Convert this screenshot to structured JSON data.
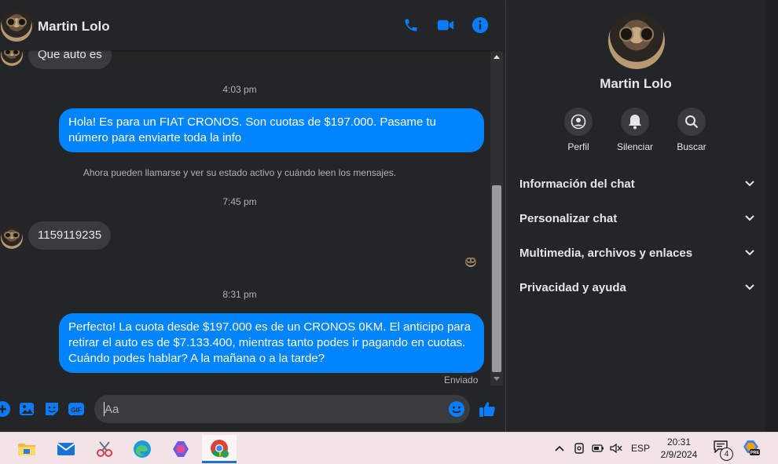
{
  "contact": {
    "name": "Martin Lolo"
  },
  "header": {
    "icons": [
      "phone-icon",
      "video-icon",
      "info-icon"
    ]
  },
  "messages": {
    "m1": "Que auto es",
    "ts1": "4:03 pm",
    "m2": "Hola! Es para un FIAT CRONOS. Son cuotas de $197.000. Pasame tu número para enviarte toda la info",
    "system": "Ahora pueden llamarse y ver su estado activo y cuándo leen los mensajes.",
    "ts2": "7:45 pm",
    "m3": "1159119235",
    "ts3": "8:31 pm",
    "m4": "Perfecto! La cuota desde $197.000 es de un CRONOS 0KM. El anticipo para retirar el auto es de $7.133.400, mientras tanto podes ir pagando en cuotas. Cuándo podes hablar? A la mañana o a la tarde?",
    "status": "Enviado"
  },
  "composer": {
    "placeholder": "Aa"
  },
  "info": {
    "name": "Martin Lolo",
    "actions": [
      {
        "label": "Perfil",
        "icon": "profile-icon"
      },
      {
        "label": "Silenciar",
        "icon": "bell-icon"
      },
      {
        "label": "Buscar",
        "icon": "search-icon"
      }
    ],
    "sections": [
      {
        "label": "Información del chat"
      },
      {
        "label": "Personalizar chat"
      },
      {
        "label": "Multimedia, archivos y enlaces"
      },
      {
        "label": "Privacidad y ayuda"
      }
    ]
  },
  "taskbar": {
    "lang": "ESP",
    "time": "20:31",
    "date": "2/9/2024",
    "notifications": "4"
  },
  "colors": {
    "accent": "#0084ff",
    "background": "#242526",
    "bubble_in": "#3a3b3c",
    "taskbar": "#f2e4e6"
  }
}
